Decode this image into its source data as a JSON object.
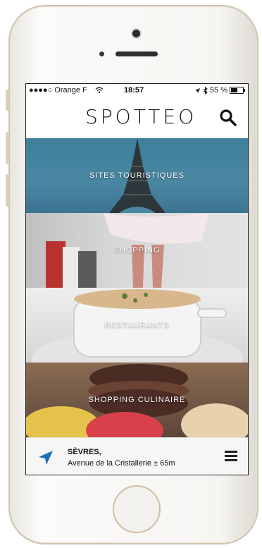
{
  "status_bar": {
    "carrier": "●●●●○ Orange F",
    "time": "18:57",
    "battery": "55 %",
    "battery_level": 0.55
  },
  "header": {
    "logo": "SPOTTEO",
    "search_icon": "search-icon"
  },
  "categories": [
    {
      "label": "SITES TOURISTIQUES"
    },
    {
      "label": "SHOPPING"
    },
    {
      "label": "RESTAURANTS"
    },
    {
      "label": "SHOPPING CULINAIRE"
    }
  ],
  "footer": {
    "location_icon": "location-arrow-icon",
    "city": "SÈVRES,",
    "address": "Avenue de la Cristallerie ± 65m",
    "menu_icon": "hamburger-menu-icon"
  },
  "colors": {
    "tourism_tile": "#3d7f9c",
    "location_arrow": "#1d6fb8"
  }
}
